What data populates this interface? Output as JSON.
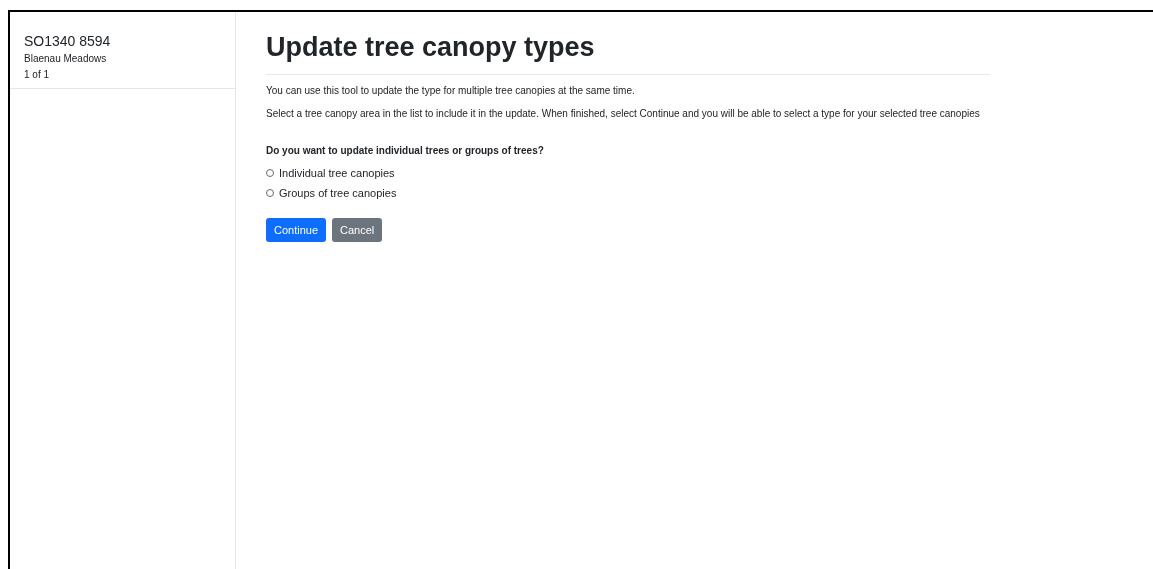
{
  "sidebar": {
    "grid_ref": "SO1340 8594",
    "place": "Blaenau Meadows",
    "count": "1 of 1"
  },
  "title": "Update tree canopy types",
  "paragraphs": [
    "You can use this tool to update the type for multiple tree canopies at the same time.",
    "Select a tree canopy area in the list to include it in the update. When finished, select Continue and you will be able to select a type for your selected tree canopies"
  ],
  "question": "Do you want to update individual trees or groups of trees?",
  "options": [
    {
      "label": "Individual tree canopies",
      "selected": false
    },
    {
      "label": "Groups of tree canopies",
      "selected": false
    }
  ],
  "buttons": [
    {
      "label": "Continue",
      "kind": "primary"
    },
    {
      "label": "Cancel",
      "kind": "secondary"
    }
  ]
}
